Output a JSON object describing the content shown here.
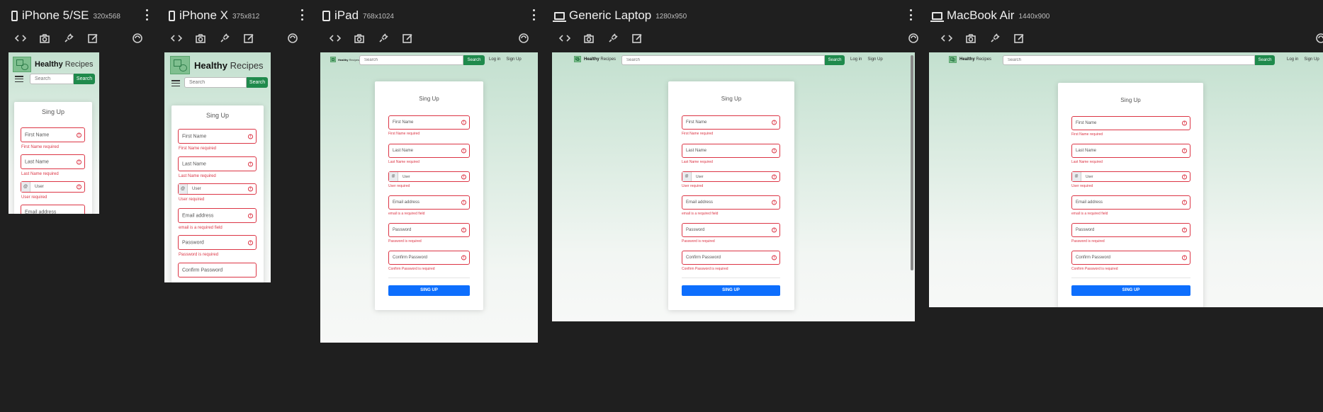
{
  "colors": {
    "accent_green": "#1f8a4c",
    "error_red": "#dc3545",
    "primary_blue": "#0d6efd",
    "bg_dark": "#1f1f1f"
  },
  "devices": [
    {
      "name": "iPhone 5/SE",
      "size": "320x568",
      "icon": "phone-icon"
    },
    {
      "name": "iPhone X",
      "size": "375x812",
      "icon": "phone-icon"
    },
    {
      "name": "iPad",
      "size": "768x1024",
      "icon": "tablet-icon"
    },
    {
      "name": "Generic Laptop",
      "size": "1280x950",
      "icon": "laptop-icon"
    },
    {
      "name": "MacBook Air",
      "size": "1440x900",
      "icon": "laptop-icon"
    }
  ],
  "toolbar": [
    "code-icon",
    "camera-icon",
    "plug-icon",
    "edit-icon",
    "rotate-icon"
  ],
  "site": {
    "brand_bold": "Healthy",
    "brand_rest": " Recipes",
    "search_placeholder": "Search",
    "search_button": "Search",
    "login": "Log in",
    "signup": "Sign Up"
  },
  "form": {
    "title": "Sing Up",
    "fields": [
      {
        "placeholder": "First Name",
        "error": "First Name required"
      },
      {
        "placeholder": "Last Name",
        "error": "Last Name required"
      },
      {
        "placeholder": "User",
        "addon": "@",
        "error": "User required"
      },
      {
        "placeholder": "Email address",
        "error": "email is a required field"
      },
      {
        "placeholder": "Password",
        "error": "Password is required"
      },
      {
        "placeholder": "Confirm Password",
        "error": "Confirm Password is required"
      }
    ],
    "submit": "SING UP",
    "warn_glyph": "!"
  }
}
